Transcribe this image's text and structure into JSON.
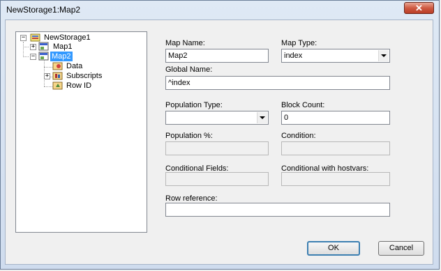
{
  "window": {
    "title": "NewStorage1:Map2",
    "close_label": "✕"
  },
  "tree": {
    "root": {
      "label": "NewStorage1",
      "expander": "−"
    },
    "map1": {
      "label": "Map1",
      "expander": "+"
    },
    "map2": {
      "label": "Map2",
      "expander": "−"
    },
    "data": {
      "label": "Data"
    },
    "subscripts": {
      "label": "Subscripts",
      "expander": "+"
    },
    "rowid": {
      "label": "Row ID"
    }
  },
  "form": {
    "map_name": {
      "label": "Map Name:",
      "value": "Map2"
    },
    "map_type": {
      "label": "Map Type:",
      "value": "index"
    },
    "global_name": {
      "label": "Global Name:",
      "value": "^index"
    },
    "population_type": {
      "label": "Population Type:",
      "value": ""
    },
    "block_count": {
      "label": "Block Count:",
      "value": "0"
    },
    "population_pct": {
      "label": "Population %:",
      "value": ""
    },
    "condition": {
      "label": "Condition:",
      "value": ""
    },
    "conditional_fields": {
      "label": "Conditional Fields:",
      "value": ""
    },
    "conditional_hostvars": {
      "label": "Conditional with hostvars:",
      "value": ""
    },
    "row_reference": {
      "label": "Row reference:",
      "value": ""
    }
  },
  "buttons": {
    "ok": "OK",
    "cancel": "Cancel"
  },
  "colors": {
    "selection": "#3399ff",
    "window_frame": "#cfdcee",
    "close_button": "#cf5a42"
  },
  "icons": {
    "root": "storage-icon",
    "map": "map-icon",
    "data": "data-icon",
    "subscripts": "subscripts-icon",
    "rowid": "rowid-icon"
  }
}
